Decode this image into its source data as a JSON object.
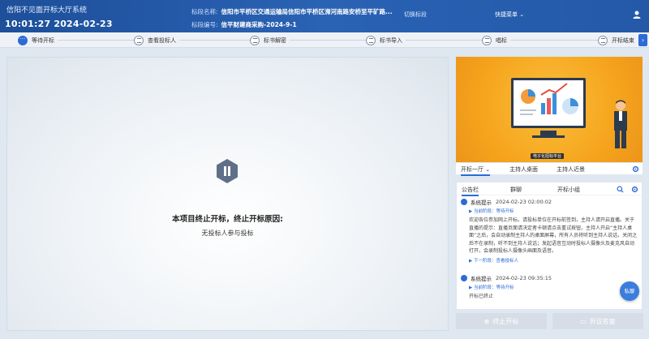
{
  "header": {
    "system_title": "信阳不见面开标大厅系统",
    "clock": "10:01:27 2024-02-23",
    "bid_name_label": "标段名称:",
    "bid_name_value": "信阳市平桥区交通运输局信阳市平桥区浉河南路安桥至平矿路...",
    "bid_code_label": "标段编号:",
    "bid_code_value": "信平财建商采购-2024-9-1",
    "switch_label": "切换标段",
    "quick_menu_label": "快捷菜单 ⌄"
  },
  "steps": [
    {
      "label": "等待开标",
      "active": true
    },
    {
      "label": "查看投标人",
      "active": false
    },
    {
      "label": "标书解密",
      "active": false
    },
    {
      "label": "标书导入",
      "active": false
    },
    {
      "label": "唱标",
      "active": false
    },
    {
      "label": "开标结束",
      "active": false
    }
  ],
  "main": {
    "end_message": "本项目终止开标，终止开标原因:",
    "end_reason": "无投标人参与投标"
  },
  "banner": {
    "tag_text": "电子化招标平台"
  },
  "side_tabs": [
    "开标一厅 ⌄",
    "主持人桌面",
    "主持人近景"
  ],
  "notice_tabs": [
    "公告栏",
    "群聊",
    "开标小组"
  ],
  "messages": [
    {
      "who": "系统提示",
      "time": "2024-02-23 02:00:02",
      "phase": "▶ 当前阶段：等待开标",
      "body": "欢迎各位参加网上开标。请投标单位在开标前签到，主持人请开启直播。关于直播的提示：直播页面请决定者卡顿请点击重试按钮，主持人开启“主持人桌面”之后，会自动录制主持人的桌面屏幕，所有人员将听到主持人说话，关闭之后不在录制，听不到主持人说话；发起语音互动时投标人摄像头及麦克风自动打开，会录制投标人摄像头画面及语音。",
      "next": "▶ 下一阶段：查看投标人"
    },
    {
      "who": "系统提示",
      "time": "2024-02-23 09:35:15",
      "phase": "▶ 当前阶段：等待开标",
      "body": "开标已终止",
      "next": ""
    }
  ],
  "private_chat_label": "私聊",
  "buttons": {
    "terminate": "终止开标",
    "objection": "异议答复"
  },
  "colors": {
    "header_bg": "#2459a8",
    "accent": "#2c6bd6",
    "banner_bg": "#f6a51d"
  }
}
